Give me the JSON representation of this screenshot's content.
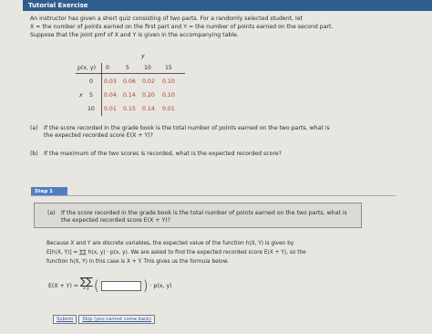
{
  "header": {
    "title": "Tutorial Exercise"
  },
  "problem": {
    "lines": [
      "An instructor has given a short quiz consisting of two parts. For a randomly selected student, let",
      "X = the number of points earned on the first part and Y = the number of points earned on the second part.",
      "Suppose that the joint pmf of X and Y is given in the accompanying table."
    ]
  },
  "pmf_table": {
    "y_label": "y",
    "x_label": "x",
    "corner": "p(x, y)",
    "y_values": [
      "0",
      "5",
      "10",
      "15"
    ],
    "rows": [
      {
        "x": "0",
        "values": [
          "0.03",
          "0.06",
          "0.02",
          "0.10"
        ]
      },
      {
        "x": "5",
        "values": [
          "0.04",
          "0.14",
          "0.20",
          "0.10"
        ]
      },
      {
        "x": "10",
        "values": [
          "0.01",
          "0.15",
          "0.14",
          "0.01"
        ]
      }
    ]
  },
  "questions": {
    "a": {
      "tag": "(a)",
      "lines": [
        "If the score recorded in the grade book is the total number of points earned on the two parts, what is",
        "the expected recorded score E(X + Y)?"
      ]
    },
    "b": {
      "tag": "(b)",
      "lines": [
        "If the maximum of the two scores is recorded, what is the expected recorded score?"
      ]
    }
  },
  "step": {
    "label": "Step 1",
    "box": {
      "tag": "(a)",
      "lines": [
        "If the score recorded in the grade book is the total number of points earned on the two parts, what is",
        "the expected recorded score E(X + Y)?"
      ]
    },
    "explanation": [
      "Because X and Y are discrete variables, the expected value of the function h(X, Y) is given by",
      "E[h(X, Y)] = ∑∑ h(x, y) · p(x, y). We are asked to find the expected recorded score E(X + Y), so the",
      "function h(X, Y) in this case is X + Y. This gives us the formula below."
    ],
    "formula": {
      "lhs": "E(X + Y) =",
      "sums": "∑∑",
      "sub": "x  y",
      "open": "(",
      "close": ")",
      "rhs": "· p(x, y)",
      "answer_value": ""
    }
  },
  "buttons": {
    "submit": "Submit",
    "skip": "Skip (you cannot come back)"
  }
}
